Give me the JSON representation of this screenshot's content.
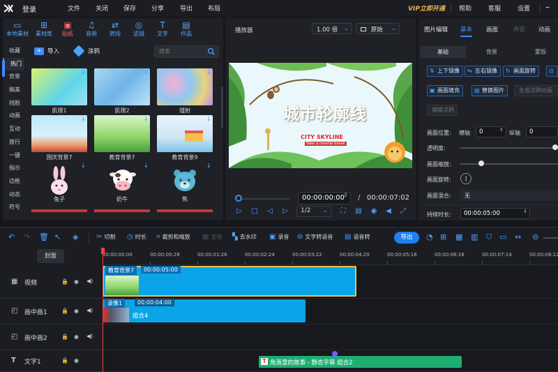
{
  "titlebar": {
    "login": "登录",
    "menus": [
      "文件",
      "关闭",
      "保存",
      "分享",
      "导出",
      "布局"
    ],
    "vip": "VIP立即开通",
    "right_menus": [
      "帮助",
      "客服",
      "设置"
    ]
  },
  "library": {
    "tabs": [
      {
        "label": "本地素材",
        "icon": "folder-icon"
      },
      {
        "label": "素材库",
        "icon": "library-icon"
      },
      {
        "label": "贴纸",
        "icon": "sticker-icon"
      },
      {
        "label": "音频",
        "icon": "audio-icon"
      },
      {
        "label": "转场",
        "icon": "transition-icon"
      },
      {
        "label": "滤镜",
        "icon": "filter-icon"
      },
      {
        "label": "文字",
        "icon": "text-icon"
      },
      {
        "label": "作品",
        "icon": "works-icon"
      }
    ],
    "categories": [
      "收藏",
      "热门",
      "背景",
      "稿美",
      "挡脸",
      "动画",
      "互动",
      "旅行",
      "一键",
      "指示",
      "边框",
      "动态",
      "符号"
    ],
    "import_label": "导入",
    "paint_label": "涂鸦",
    "search_placeholder": "搜索",
    "items": [
      {
        "label": "肌理1"
      },
      {
        "label": "肌理2"
      },
      {
        "label": "镭射"
      },
      {
        "label": "国庆背景7"
      },
      {
        "label": "教育背景7"
      },
      {
        "label": "教育背景9"
      },
      {
        "label": "兔子"
      },
      {
        "label": "奶牛"
      },
      {
        "label": "熊"
      }
    ]
  },
  "player": {
    "title": "播放器",
    "speed": "1.00 倍",
    "ratio_mode": "原始",
    "video_title": "城市轮廓线",
    "video_sub": "CITY SKYLINE",
    "video_sub2": "Take a mental break",
    "current_time": "00:00:00:00",
    "slash": "/",
    "total_time": "00:00:07:02",
    "quality": "1/2"
  },
  "props": {
    "tabs": [
      "图片编辑",
      "基本",
      "画面",
      "声音",
      "动画"
    ],
    "subtabs": [
      "基础",
      "背景",
      "蒙版"
    ],
    "buttons": [
      "上下镜像",
      "左右镜像",
      "画面旋转",
      "画面填充",
      "替换图片",
      "生成涂鸦动画",
      "编辑涂鸦"
    ],
    "position_label": "画面位置:",
    "x_label": "横轴",
    "x_value": "0",
    "y_label": "纵轴",
    "y_value": "0",
    "opacity_label": "透明度:",
    "opacity": 1.0,
    "zoom_label": "画面缩放:",
    "zoom": 0.2,
    "rotate_label": "画面旋转:",
    "blend_label": "画面混合:",
    "blend_value": "无",
    "duration_label": "持续时长:",
    "duration_value": "00:00:05:00"
  },
  "toolbar": {
    "cut": "切割",
    "duration": "时长",
    "crop": "裁剪和缩放",
    "freeze": "定格",
    "watermark": "去水印",
    "record": "录音",
    "tts": "文字转语音",
    "stt": "语音转",
    "export": "导出"
  },
  "timeline": {
    "cover": "封面",
    "ruler": [
      "00:00:00:00",
      "00:00:00:28",
      "00:00:01:26",
      "00:00:02:24",
      "00:00:03:22",
      "00:00:04:20",
      "00:00:05:18",
      "00:00:06:16",
      "00:00:07:14",
      "00:00:08:12"
    ],
    "tracks": [
      {
        "name": "视频",
        "icon": "video-track-icon"
      },
      {
        "name": "画中画1",
        "icon": "pip-track-icon"
      },
      {
        "name": "画中画2",
        "icon": "pip-track-icon"
      },
      {
        "name": "文字1",
        "icon": "text-track-icon"
      }
    ],
    "clips": {
      "video_name": "教育背景7",
      "video_dur": "00:00:05:00",
      "pip_name": "录像1",
      "pip_dur": "00:00:04:00",
      "pip_group": "组合4",
      "text_content": "角落里的故事 - 静态字幕",
      "text_group": "组合2"
    }
  },
  "colors": {
    "accent": "#1e7ff2",
    "vip": "#e8b452",
    "clip": "#0aa4e8",
    "text_clip": "#1fae72",
    "playhead": "#ff3b3b"
  }
}
